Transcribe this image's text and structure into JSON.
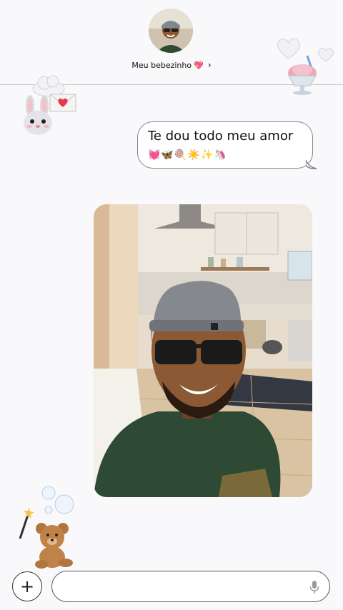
{
  "header": {
    "contact_name": "Meu bebezinho",
    "name_emoji": "💖",
    "chevron": "›"
  },
  "messages": [
    {
      "text": "Te dou todo meu amor",
      "emojis": "💓🦋🍭☀️✨🦄",
      "sender": "me"
    }
  ],
  "photo": {
    "subject": "cartoon selfie in kitchen"
  },
  "composer": {
    "add_label": "+",
    "input_value": "",
    "input_placeholder": ""
  },
  "colors": {
    "background": "#f9f9fb",
    "bubble_border": "#7e8793",
    "heart": "#e8559a"
  },
  "icons": [
    "bunny-sticker-icon",
    "cloud-letter-icon",
    "hearts-icon",
    "shaved-ice-icon",
    "bubbles-icon",
    "magic-wand-icon",
    "teddy-bear-icon",
    "mic-icon",
    "plus-icon"
  ]
}
